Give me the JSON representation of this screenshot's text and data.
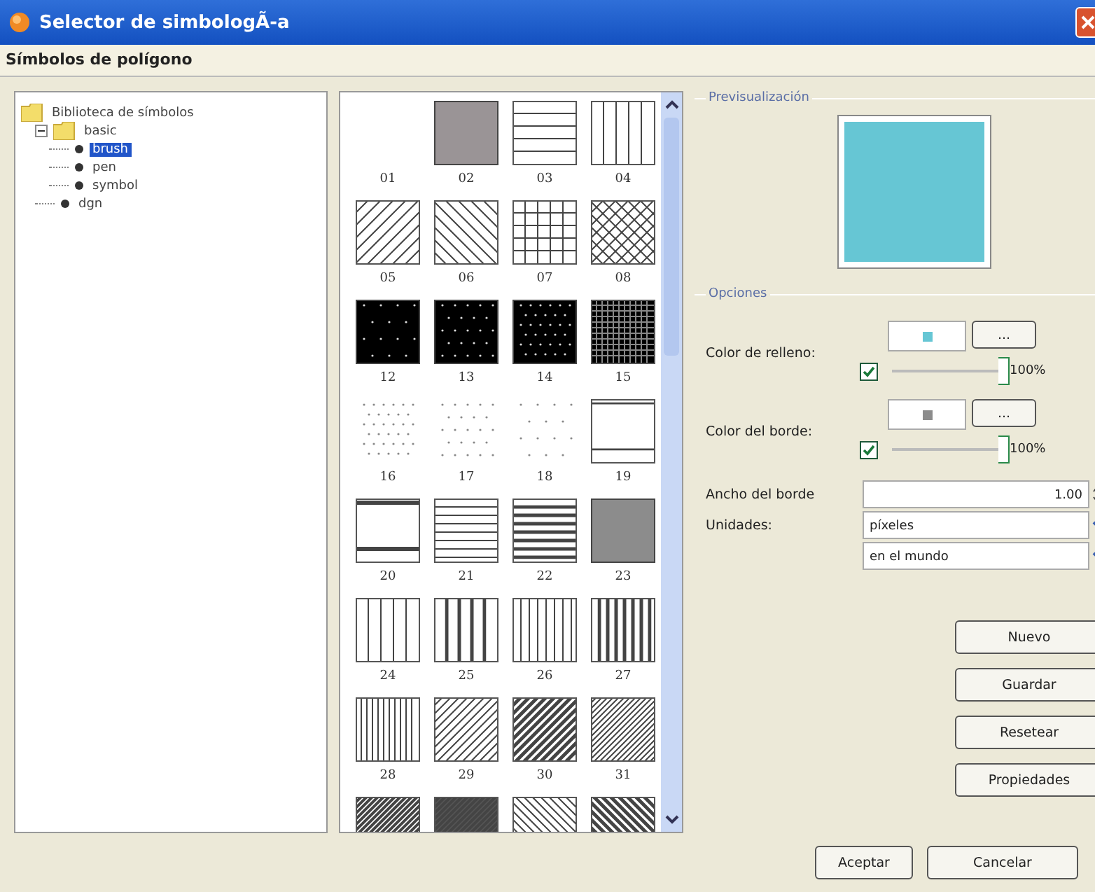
{
  "window": {
    "title": "Selector de simbologÃ-a"
  },
  "header": "Símbolos de polígono",
  "tree": [
    {
      "label": "Biblioteca de símbolos",
      "kind": "folder",
      "selected": false,
      "children": [
        {
          "label": "basic",
          "kind": "folder",
          "expanded": true,
          "selected": false,
          "children": [
            {
              "label": "brush",
              "kind": "leaf",
              "selected": true
            },
            {
              "label": "pen",
              "kind": "leaf",
              "selected": false
            },
            {
              "label": "symbol",
              "kind": "leaf",
              "selected": false
            }
          ]
        },
        {
          "label": "dgn",
          "kind": "leaf",
          "selected": false
        }
      ]
    }
  ],
  "symbols": [
    {
      "label": "01",
      "kind": "blank",
      "selected": false
    },
    {
      "label": "02",
      "kind": "solid",
      "color": "#9a9496",
      "selected": false
    },
    {
      "label": "03",
      "kind": "hlines",
      "selected": false
    },
    {
      "label": "04",
      "kind": "vlines",
      "selected": false
    },
    {
      "label": "05",
      "kind": "fdiag",
      "selected": false
    },
    {
      "label": "06",
      "kind": "bdiag",
      "selected": false
    },
    {
      "label": "07",
      "kind": "grid",
      "selected": false
    },
    {
      "label": "08",
      "kind": "xdiag",
      "selected": false
    },
    {
      "label": "12",
      "kind": "sparsedots",
      "color": "#000000",
      "selected": false
    },
    {
      "label": "13",
      "kind": "dots",
      "color": "#000000",
      "selected": false
    },
    {
      "label": "14",
      "kind": "densedots",
      "color": "#000000",
      "selected": false
    },
    {
      "label": "15",
      "kind": "finegrid",
      "color": "#000000",
      "selected": false
    },
    {
      "label": "16",
      "kind": "densedots",
      "selected": false
    },
    {
      "label": "17",
      "kind": "dots",
      "selected": false
    },
    {
      "label": "18",
      "kind": "sparsedots",
      "selected": false
    },
    {
      "label": "19",
      "kind": "frame",
      "selected": false
    },
    {
      "label": "20",
      "kind": "band",
      "selected": false
    },
    {
      "label": "21",
      "kind": "hmid",
      "selected": false
    },
    {
      "label": "22",
      "kind": "hbars",
      "selected": false
    },
    {
      "label": "23",
      "kind": "solid",
      "color": "#8c8c8c",
      "selected": false
    },
    {
      "label": "24",
      "kind": "vlines",
      "selected": false
    },
    {
      "label": "25",
      "kind": "vbars",
      "selected": false
    },
    {
      "label": "26",
      "kind": "vmid",
      "selected": false
    },
    {
      "label": "27",
      "kind": "vmidbars",
      "selected": false
    },
    {
      "label": "28",
      "kind": "vfine",
      "selected": false
    },
    {
      "label": "29",
      "kind": "fmid",
      "selected": false
    },
    {
      "label": "30",
      "kind": "fbars",
      "selected": false
    },
    {
      "label": "31",
      "kind": "ffine",
      "selected": false
    },
    {
      "kind": "ffinebars",
      "selected": false
    },
    {
      "kind": "ffinebars",
      "color": "#555555",
      "selected": false
    },
    {
      "kind": "bmid",
      "selected": false
    },
    {
      "kind": "bbars",
      "selected": false
    }
  ],
  "preview": {
    "title": "Previsualización",
    "color": "#66c6d4"
  },
  "options": {
    "title": "Opciones",
    "fill": {
      "label": "Color de relleno:",
      "color": "#66c6d4",
      "button": "...",
      "enabled": true,
      "level": 1,
      "reading": "100%"
    },
    "border": {
      "label": "Color del borde:",
      "color": "#8c8c8c",
      "button": "...",
      "enabled": true,
      "level": 1,
      "reading": "100%"
    },
    "width": {
      "label": "Ancho del borde",
      "value": "1.00"
    },
    "units": {
      "label": "Unidades:",
      "value": "píxeles"
    },
    "space": {
      "value": "en el mundo"
    }
  },
  "side_buttons": [
    "Nuevo",
    "Guardar",
    "Resetear",
    "Propiedades"
  ],
  "buttons": [
    "Aceptar",
    "Cancelar"
  ]
}
